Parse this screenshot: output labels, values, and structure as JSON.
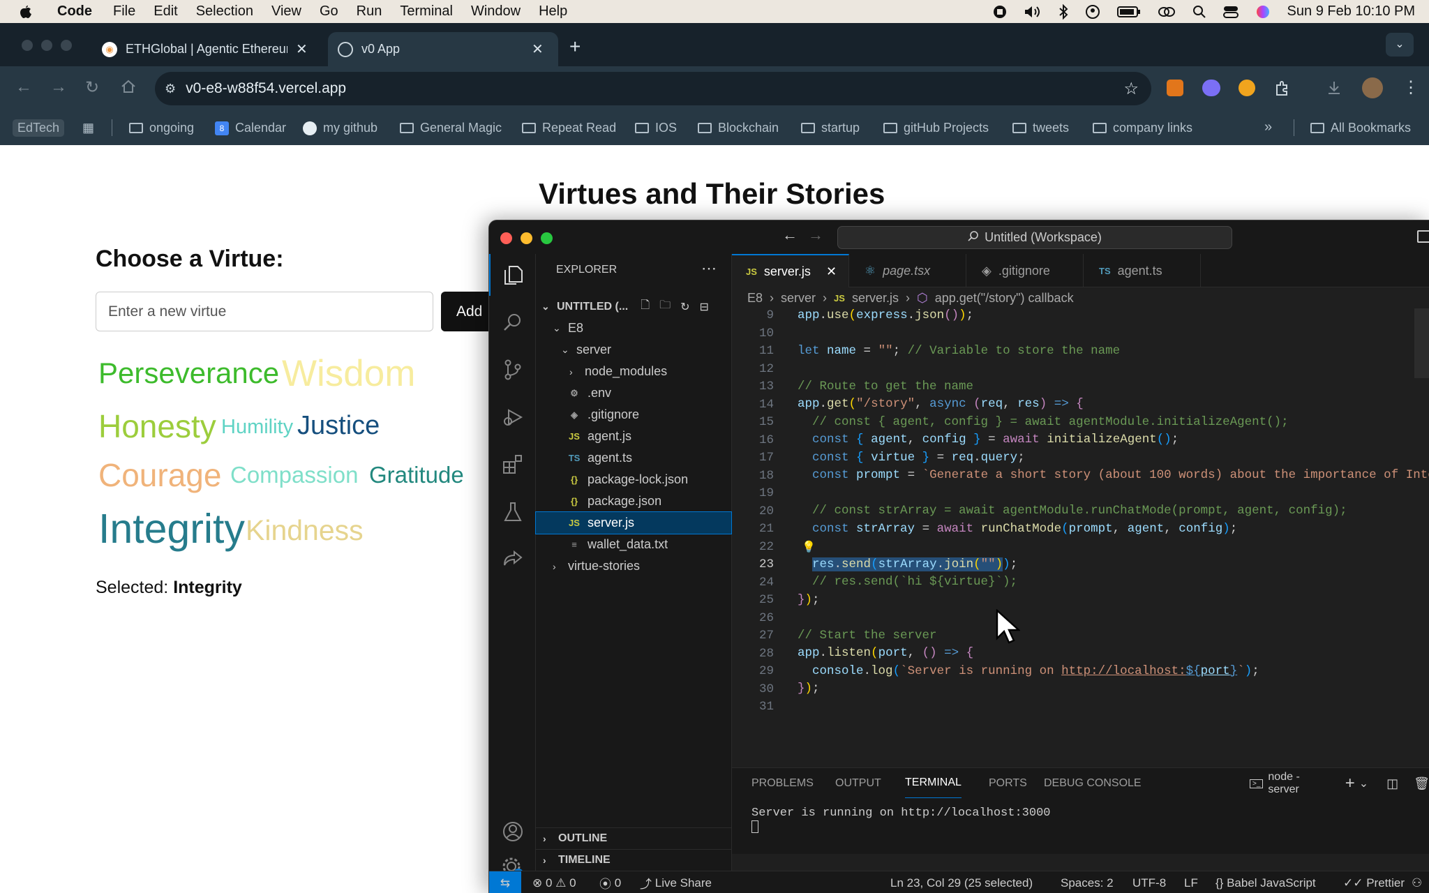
{
  "menubar": {
    "app_name": "Code",
    "items": [
      "File",
      "Edit",
      "Selection",
      "View",
      "Go",
      "Run",
      "Terminal",
      "Window",
      "Help"
    ],
    "datetime": "Sun 9 Feb  10:10 PM"
  },
  "browser": {
    "tabs": [
      {
        "title": "ETHGlobal | Agentic Ethereum",
        "icon": "ethglobal-favicon"
      },
      {
        "title": "v0 App",
        "icon": "globe-icon"
      }
    ],
    "url": "v0-e8-w88f54.vercel.app",
    "bookmarks": {
      "profile": "EdTech",
      "items": [
        "ongoing",
        "Calendar",
        "my github",
        "General Magic",
        "Repeat Read",
        "IOS",
        "Blockchain",
        "startup",
        "gitHub Projects",
        "tweets",
        "company links"
      ],
      "all": "All Bookmarks"
    }
  },
  "webpage": {
    "title": "Virtues and Their Stories",
    "choose_heading": "Choose a Virtue:",
    "input_placeholder": "Enter a new virtue",
    "add_label": "Add",
    "virtues": [
      {
        "label": "Perseverance",
        "color": "#3dbb2c"
      },
      {
        "label": "Wisdom",
        "color": "#f7ec9e"
      },
      {
        "label": "Honesty",
        "color": "#9ccd3c"
      },
      {
        "label": "Humility",
        "color": "#5fd3c4"
      },
      {
        "label": "Justice",
        "color": "#164f7e"
      },
      {
        "label": "Courage",
        "color": "#f0b37a"
      },
      {
        "label": "Compassion",
        "color": "#7fdfc9"
      },
      {
        "label": "Gratitude",
        "color": "#22887e"
      },
      {
        "label": "Integrity",
        "color": "#267c8c"
      },
      {
        "label": "Kindness",
        "color": "#e6d48e"
      }
    ],
    "selected_label": "Selected:",
    "selected_value": "Integrity"
  },
  "vscode": {
    "command_center": "Untitled (Workspace)",
    "explorer": {
      "header": "EXPLORER",
      "workspace": "UNTITLED (...",
      "tree": [
        {
          "label": "E8",
          "type": "folder-open"
        },
        {
          "label": "server",
          "type": "folder-open"
        },
        {
          "label": "node_modules",
          "type": "folder"
        },
        {
          "label": ".env",
          "type": "gear"
        },
        {
          "label": ".gitignore",
          "type": "git"
        },
        {
          "label": "agent.js",
          "type": "js"
        },
        {
          "label": "agent.ts",
          "type": "ts"
        },
        {
          "label": "package-lock.json",
          "type": "json"
        },
        {
          "label": "package.json",
          "type": "json"
        },
        {
          "label": "server.js",
          "type": "js"
        },
        {
          "label": "wallet_data.txt",
          "type": "txt"
        },
        {
          "label": "virtue-stories",
          "type": "folder"
        }
      ],
      "outline": "OUTLINE",
      "timeline": "TIMELINE"
    },
    "tabs": [
      {
        "label": "server.js",
        "icon": "JS"
      },
      {
        "label": "page.tsx",
        "icon": "react"
      },
      {
        "label": ".gitignore",
        "icon": "git"
      },
      {
        "label": "agent.ts",
        "icon": "TS"
      }
    ],
    "breadcrumb": [
      "E8",
      "server",
      "server.js",
      "app.get(\"/story\") callback"
    ],
    "line_numbers": [
      "9",
      "10",
      "11",
      "12",
      "13",
      "14",
      "15",
      "16",
      "17",
      "18",
      "19",
      "20",
      "21",
      "22",
      "23",
      "24",
      "25",
      "26",
      "27",
      "28",
      "29",
      "30",
      "31"
    ],
    "panel_tabs": [
      "PROBLEMS",
      "OUTPUT",
      "TERMINAL",
      "PORTS",
      "DEBUG CONSOLE"
    ],
    "terminal_name": "node - server",
    "terminal_output": "Server is running on http://localhost:3000",
    "status": {
      "errors": "0",
      "warnings": "0",
      "ports": "0",
      "live_share": "Live Share",
      "cursor": "Ln 23, Col 29 (25 selected)",
      "spaces": "Spaces: 2",
      "encoding": "UTF-8",
      "eol": "LF",
      "language": "Babel JavaScript",
      "formatter": "Prettier"
    }
  }
}
